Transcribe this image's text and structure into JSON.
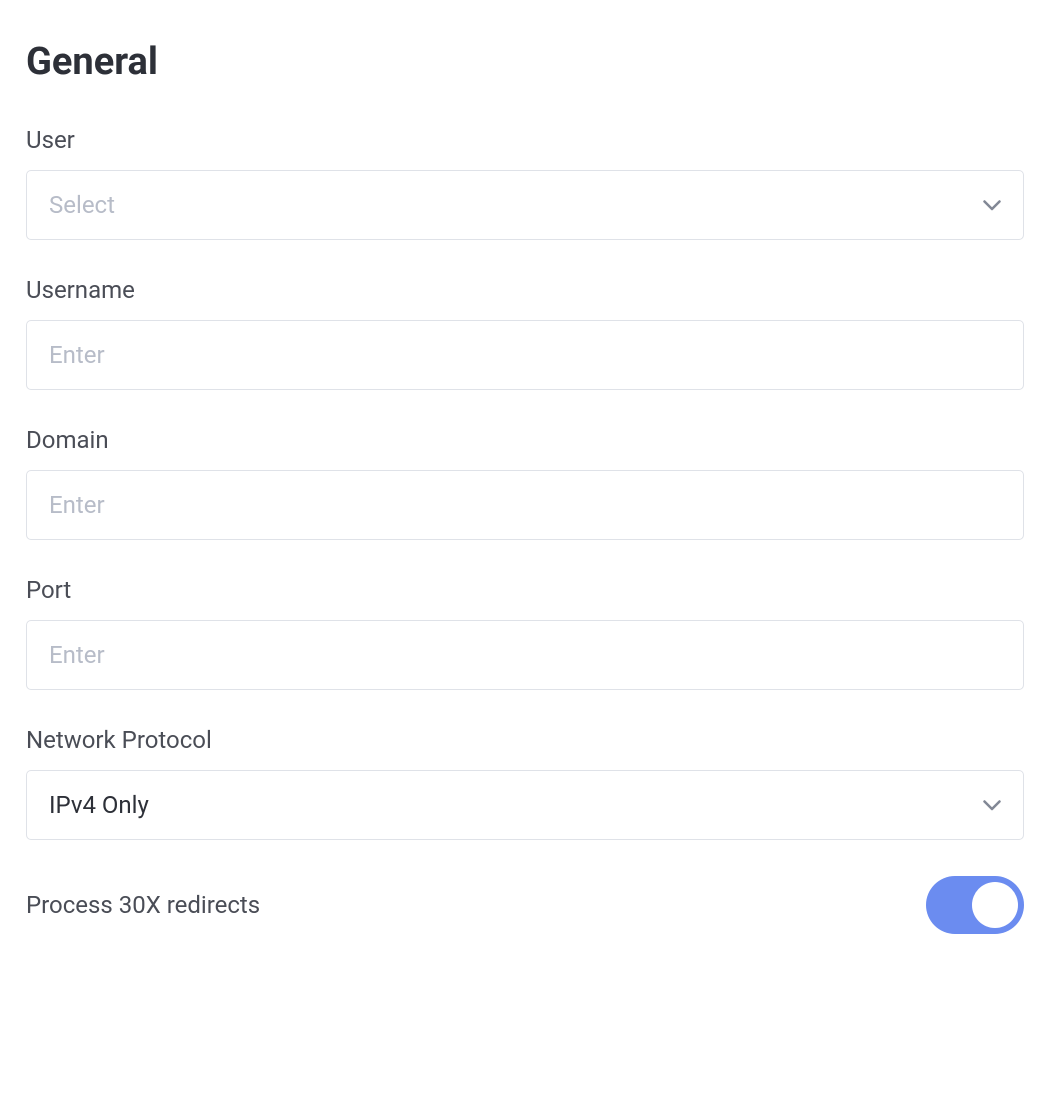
{
  "section": {
    "title": "General"
  },
  "fields": {
    "user": {
      "label": "User",
      "placeholder": "Select",
      "value": ""
    },
    "username": {
      "label": "Username",
      "placeholder": "Enter",
      "value": ""
    },
    "domain": {
      "label": "Domain",
      "placeholder": "Enter",
      "value": ""
    },
    "port": {
      "label": "Port",
      "placeholder": "Enter",
      "value": ""
    },
    "network_protocol": {
      "label": "Network Protocol",
      "value": "IPv4 Only"
    },
    "process_redirects": {
      "label": "Process 30X redirects",
      "enabled": true
    }
  },
  "colors": {
    "toggle_on": "#6b8cf0",
    "border": "#dfe2e8",
    "text_primary": "#2d3038",
    "text_label": "#4a4d56",
    "placeholder": "#b7bcc8"
  }
}
